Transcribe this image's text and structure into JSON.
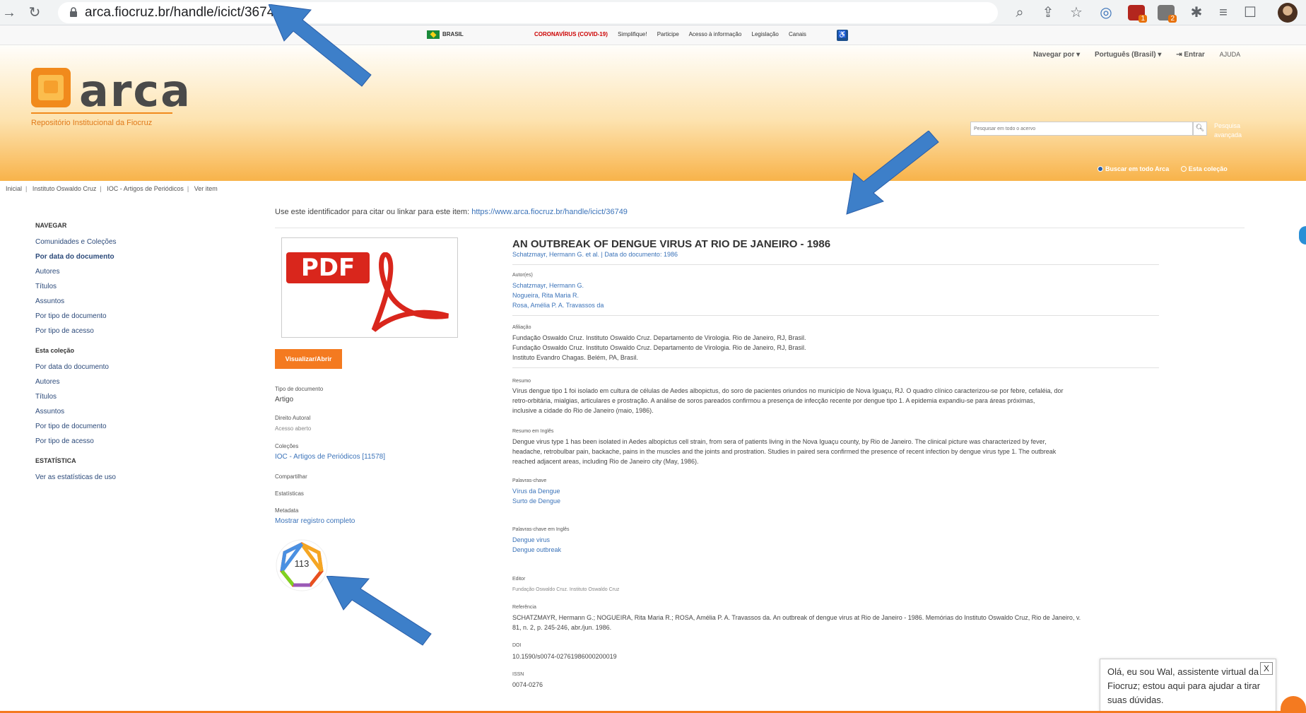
{
  "browser": {
    "url": "arca.fiocruz.br/handle/icict/36749",
    "ext_badge_1": "1",
    "ext_badge_2": "2"
  },
  "gov_bar": {
    "brasil": "BRASIL",
    "links": [
      "CORONAVÍRUS (COVID-19)",
      "Simplifique!",
      "Participe",
      "Acesso à informação",
      "Legislação",
      "Canais"
    ]
  },
  "header": {
    "logo_word": "arca",
    "logo_sub": "Repositório Institucional da Fiocruz",
    "nav_browse": "Navegar por ▾",
    "nav_lang": "Português (Brasil) ▾",
    "nav_login": "⇥ Entrar",
    "nav_help": "AJUDA",
    "search_placeholder": "Pesquisar em todo o acervo",
    "adv_search": "Pesquisa avançada",
    "scope_all": "Buscar em todo Arca",
    "scope_collection": "Esta coleção"
  },
  "breadcrumb": [
    "Inicial",
    "Instituto Oswaldo Cruz",
    "IOC - Artigos de Periódicos",
    "Ver item"
  ],
  "sidebar": {
    "nav_head": "NAVEGAR",
    "nav_items": [
      "Comunidades e Coleções",
      "Por data do documento",
      "Autores",
      "Títulos",
      "Assuntos",
      "Por tipo de documento",
      "Por tipo de acesso"
    ],
    "collection_head": "Esta coleção",
    "collection_items": [
      "Por data do documento",
      "Autores",
      "Títulos",
      "Assuntos",
      "Por tipo de documento",
      "Por tipo de acesso"
    ],
    "stats_head": "ESTATÍSTICA",
    "stats_item": "Ver as estatísticas de uso"
  },
  "cite": {
    "label": "Use este identificador para citar ou linkar para este item:",
    "url": "https://www.arca.fiocruz.br/handle/icict/36749"
  },
  "left_meta": {
    "pdf_label": "PDF",
    "view_button": "Visualizar/Abrir",
    "doc_type_label": "Tipo de documento",
    "doc_type": "Artigo",
    "rights_label": "Direito Autoral",
    "rights": "Acesso aberto",
    "collections_label": "Coleções",
    "collection": "IOC - Artigos de Periódicos [11578]",
    "share_label": "Compartilhar",
    "stats_label": "Estatísticas",
    "metadata_label": "Metadata",
    "metadata_link": "Mostrar registro completo",
    "altmetric_score": "113"
  },
  "item": {
    "title": "AN OUTBREAK OF DENGUE VIRUS AT RIO DE JANEIRO - 1986",
    "subtitle": "Schatzmayr, Hermann G. et al. | Data do documento: 1986",
    "authors_label": "Autor(es)",
    "authors": [
      "Schatzmayr, Hermann G.",
      "Nogueira, Rita Maria R.",
      "Rosa, Amélia P. A. Travassos da"
    ],
    "affil_label": "Afiliação",
    "affiliations": [
      "Fundação Oswaldo Cruz. Instituto Oswaldo Cruz. Departamento de Virologia. Rio de Janeiro, RJ, Brasil.",
      "Fundação Oswaldo Cruz. Instituto Oswaldo Cruz. Departamento de Virologia. Rio de Janeiro, RJ, Brasil.",
      "Instituto Evandro Chagas. Belém, PA, Brasil."
    ],
    "abstract_label": "Resumo",
    "abstract_lines": [
      "Vírus dengue tipo 1 foi isolado em cultura de células de Aedes albopictus, do soro de pacientes oriundos no município de Nova Iguaçu, RJ. O quadro clínico caracterizou-se por febre, cefaléia, dor",
      "retro-orbitária, mialgias, articulares e prostração. A análise de soros pareados confirmou a presença de infecção recente por dengue tipo 1. A epidemia expandiu-se para áreas próximas,",
      "inclusive a cidade do Rio de Janeiro (maio, 1986)."
    ],
    "abstract_en_label": "Resumo em Inglês",
    "abstract_en_lines": [
      "Dengue virus type 1 has been isolated in Aedes albopictus cell strain, from sera of patients living in the Nova Iguaçu county, by Rio de Janeiro. The clinical picture was characterized by fever,",
      "headache, retrobulbar pain, backache, pains in the muscles and the joints and prostration. Studies in paired sera confirmed the presence of recent infection by dengue virus type 1. The outbreak",
      "reached adjacent areas, including Rio de Janeiro city (May, 1986)."
    ],
    "keywords_label": "Palavras-chave",
    "keywords": [
      "Vírus da Dengue",
      "Surto de Dengue"
    ],
    "keywords_en_label": "Palavras-chave em Inglês",
    "keywords_en": [
      "Dengue virus",
      "Dengue outbreak"
    ],
    "editor_label": "Editor",
    "editor": "Fundação Oswaldo Cruz. Instituto Oswaldo Cruz",
    "ref_label": "Referência",
    "ref_lines": [
      "SCHATZMAYR, Hermann G.; NOGUEIRA, Rita Maria R.; ROSA, Amélia P. A. Travassos da. An outbreak of dengue virus at Rio de Janeiro - 1986. Memórias do Instituto Oswaldo Cruz, Rio de Janeiro, v.",
      "81, n. 2, p. 245-246, abr./jun. 1986."
    ],
    "doi_label": "DOI",
    "doi": "10.1590/s0074-02761986000200019",
    "issn_label": "ISSN",
    "issn": "0074-0276"
  },
  "chat": {
    "message": "Olá, eu sou Wal, assistente virtual da Fiocruz; estou aqui para ajudar a tirar suas dúvidas.",
    "close": "X"
  },
  "colors": {
    "accent_orange": "#f47a20",
    "link_blue": "#3b73b9",
    "arrow_blue": "#3d7fc9"
  }
}
